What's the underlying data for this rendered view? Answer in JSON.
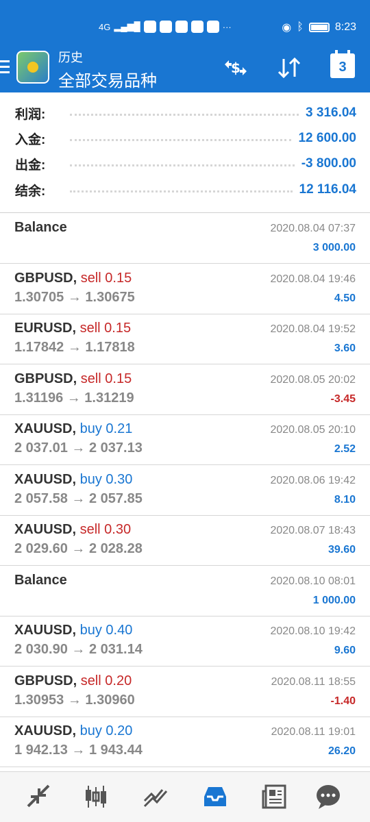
{
  "statusbar": {
    "network": "4G",
    "time": "8:23",
    "more": "···"
  },
  "appbar": {
    "subtitle": "历史",
    "title": "全部交易品种",
    "calendar_day": "3"
  },
  "summary": [
    {
      "label": "利润:",
      "value": "3 316.04"
    },
    {
      "label": "入金:",
      "value": "12 600.00"
    },
    {
      "label": "出金:",
      "value": "-3 800.00"
    },
    {
      "label": "结余:",
      "value": "12 116.04"
    }
  ],
  "deals": [
    {
      "symbol": "Balance",
      "side": "",
      "volume": "",
      "prices": "",
      "time": "2020.08.04 07:37",
      "profit": "3 000.00",
      "profit_sign": "pos"
    },
    {
      "symbol": "GBPUSD,",
      "side": "sell",
      "volume": "0.15",
      "prices": "1.30705 → 1.30675",
      "time": "2020.08.04 19:46",
      "profit": "4.50",
      "profit_sign": "pos"
    },
    {
      "symbol": "EURUSD,",
      "side": "sell",
      "volume": "0.15",
      "prices": "1.17842 → 1.17818",
      "time": "2020.08.04 19:52",
      "profit": "3.60",
      "profit_sign": "pos"
    },
    {
      "symbol": "GBPUSD,",
      "side": "sell",
      "volume": "0.15",
      "prices": "1.31196 → 1.31219",
      "time": "2020.08.05 20:02",
      "profit": "-3.45",
      "profit_sign": "neg"
    },
    {
      "symbol": "XAUUSD,",
      "side": "buy",
      "volume": "0.21",
      "prices": "2 037.01 → 2 037.13",
      "time": "2020.08.05 20:10",
      "profit": "2.52",
      "profit_sign": "pos"
    },
    {
      "symbol": "XAUUSD,",
      "side": "buy",
      "volume": "0.30",
      "prices": "2 057.58 → 2 057.85",
      "time": "2020.08.06 19:42",
      "profit": "8.10",
      "profit_sign": "pos"
    },
    {
      "symbol": "XAUUSD,",
      "side": "sell",
      "volume": "0.30",
      "prices": "2 029.60 → 2 028.28",
      "time": "2020.08.07 18:43",
      "profit": "39.60",
      "profit_sign": "pos"
    },
    {
      "symbol": "Balance",
      "side": "",
      "volume": "",
      "prices": "",
      "time": "2020.08.10 08:01",
      "profit": "1 000.00",
      "profit_sign": "pos"
    },
    {
      "symbol": "XAUUSD,",
      "side": "buy",
      "volume": "0.40",
      "prices": "2 030.90 → 2 031.14",
      "time": "2020.08.10 19:42",
      "profit": "9.60",
      "profit_sign": "pos"
    },
    {
      "symbol": "GBPUSD,",
      "side": "sell",
      "volume": "0.20",
      "prices": "1.30953 → 1.30960",
      "time": "2020.08.11 18:55",
      "profit": "-1.40",
      "profit_sign": "neg"
    },
    {
      "symbol": "XAUUSD,",
      "side": "buy",
      "volume": "0.20",
      "prices": "1 942.13 → 1 943.44",
      "time": "2020.08.11 19:01",
      "profit": "26.20",
      "profit_sign": "pos"
    }
  ],
  "bottomnav": [
    {
      "icon": "quotes-icon"
    },
    {
      "icon": "chart-icon"
    },
    {
      "icon": "trade-icon"
    },
    {
      "icon": "history-icon",
      "active": true
    },
    {
      "icon": "news-icon"
    },
    {
      "icon": "chat-icon"
    }
  ],
  "colors": {
    "accent": "#1976d2",
    "sell": "#c62828",
    "muted": "#888888"
  }
}
